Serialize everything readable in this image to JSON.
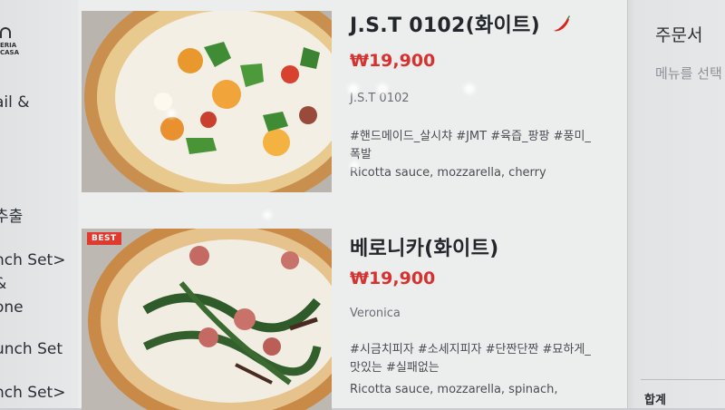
{
  "sidebar": {
    "logo_text": "ERIA\nCASA",
    "items": [
      {
        "label": "ail &"
      },
      {
        "label": "추출"
      },
      {
        "label": "nch Set>"
      },
      {
        "label": "&"
      },
      {
        "label": "one"
      },
      {
        "label": "unch Set"
      },
      {
        "label": "nch Set>"
      }
    ]
  },
  "menu": {
    "items": [
      {
        "name": "J.S.T 0102(화이트)",
        "price": "₩19,900",
        "subtitle": "J.S.T 0102",
        "tags": "#핸드메이드_살시챠 #JMT #육즙_팡팡 #풍미_폭발",
        "ingredients": "Ricotta sauce, mozzarella, cherry",
        "spicy_icon": "chili-pepper-icon",
        "badge": ""
      },
      {
        "name": "베로니카(화이트)",
        "price": "₩19,900",
        "subtitle": "Veronica",
        "tags": "#시금치피자 #소세지피자 #단짠단짠 #묘하게_맛있는 #실패없는",
        "ingredients": "Ricotta sauce, mozzarella, spinach,",
        "badge": "BEST"
      }
    ]
  },
  "order": {
    "title": "주문서",
    "hint": "메뉴를 선택",
    "total_label": "합계"
  },
  "colors": {
    "price": "#d6322f",
    "badge": "#e03a2f"
  }
}
